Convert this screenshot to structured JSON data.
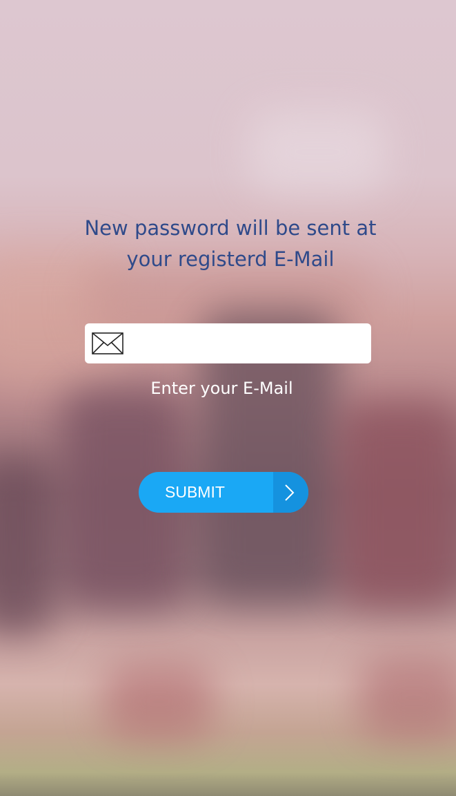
{
  "message": {
    "line1": "New password will be sent at",
    "line2": "your registerd E-Mail"
  },
  "email": {
    "value": "",
    "placeholder": "",
    "caption": "Enter your E-Mail",
    "icon": "mail-icon"
  },
  "submit": {
    "label": "SUBMIT",
    "icon": "chevron-right-icon"
  },
  "colors": {
    "heading": "#2f4a8a",
    "button": "#1aa8f5",
    "button_arrow_segment": "#1592df"
  }
}
